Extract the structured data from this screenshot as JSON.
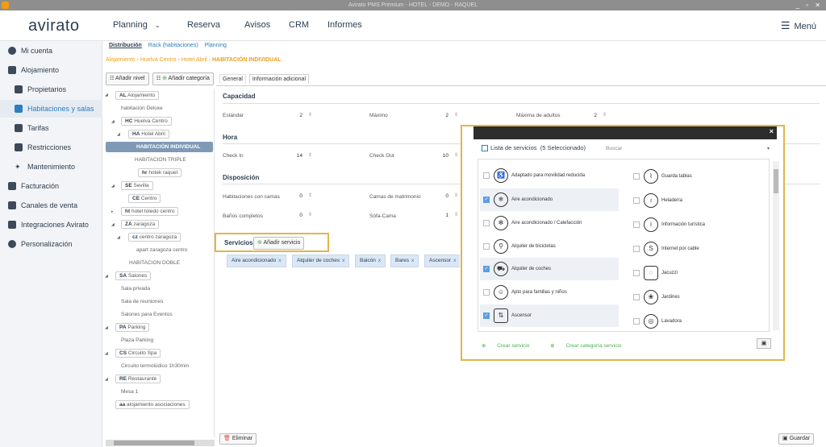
{
  "window": {
    "title": "Avirato PMS Premium - HOTEL - DEMO - RAQUEL",
    "controls": "_ ▫ ✕"
  },
  "topnav": {
    "logo": "avirato",
    "items": [
      "Planning",
      "Reserva",
      "Avisos",
      "CRM",
      "Informes"
    ],
    "menu_label": "Menú"
  },
  "sidebar": {
    "items": [
      {
        "label": "Mi cuenta",
        "icon": "user-icon"
      },
      {
        "label": "Alojamiento",
        "icon": "building-icon"
      },
      {
        "label": "Propietarios",
        "icon": "person-icon"
      },
      {
        "label": "Habitaciones y salas",
        "icon": "bed-icon"
      },
      {
        "label": "Tarifas",
        "icon": "list-icon"
      },
      {
        "label": "Restricciones",
        "icon": "calendar-icon"
      },
      {
        "label": "Mantenimiento",
        "icon": "tools-icon"
      },
      {
        "label": "Facturación",
        "icon": "invoice-icon"
      },
      {
        "label": "Canales de venta",
        "icon": "grid-icon"
      },
      {
        "label": "Integraciones Avirato",
        "icon": "plug-icon"
      },
      {
        "label": "Personalización",
        "icon": "gear-icon"
      }
    ]
  },
  "subtabs": [
    "Distribución",
    "Rack (habitaciones)",
    "Planning"
  ],
  "breadcrumb": {
    "items": [
      "Alojamiento",
      "Huelva Centro",
      "Hotel Abril"
    ],
    "current": "HABITACIÓN INDIVIDUAL",
    "sep": "›"
  },
  "tree_buttons": {
    "add_level": "Añadir nivel",
    "add_category": "Añadir categoría"
  },
  "tree": [
    {
      "code": "AL",
      "label": "Alojamiento"
    },
    {
      "label": "habitacion Deluxe"
    },
    {
      "code": "HC",
      "label": "Huelva Centro"
    },
    {
      "code": "HA",
      "label": "Hotel Abril"
    },
    {
      "label": "HABITACIÓN INDIVIDUAL"
    },
    {
      "label": "HABITACION TRIPLE"
    },
    {
      "code": "hr",
      "label": "hotek raquel"
    },
    {
      "code": "SE",
      "label": "Sevilla"
    },
    {
      "code": "CE",
      "label": "Centro"
    },
    {
      "code": "ht",
      "label": "hotel toledo centro"
    },
    {
      "code": "ZA",
      "label": "zaragoza"
    },
    {
      "code": "cz",
      "label": "centro zaragoza"
    },
    {
      "label": "apart zaragoza centro"
    },
    {
      "label": "HABITACION DOBLE"
    },
    {
      "code": "SA",
      "label": "Salones"
    },
    {
      "label": "Sala privada"
    },
    {
      "label": "Sala de reuniones"
    },
    {
      "label": "Salones para Eventos"
    },
    {
      "code": "PA",
      "label": "Parking"
    },
    {
      "label": "Plaza Parking"
    },
    {
      "code": "CS",
      "label": "Circuito Spa"
    },
    {
      "label": "Circuito termolúdico 1h30min"
    },
    {
      "code": "RE",
      "label": "Restaurante"
    },
    {
      "label": "Mesa 1"
    },
    {
      "code": "aa",
      "label": "alojamiento asociaciones"
    }
  ],
  "panel_tabs": [
    "General",
    "Información adicional"
  ],
  "capacidad": {
    "title": "Capacidad",
    "estandar_label": "Estándar",
    "estandar": "2",
    "maximo_label": "Máximo",
    "maximo": "2",
    "max_adultos_label": "Máxima de adultos",
    "max_adultos": "2"
  },
  "hora": {
    "title": "Hora",
    "checkin_label": "Check In",
    "checkin": "14",
    "checkout_label": "Check Out",
    "checkout": "10"
  },
  "disposicion": {
    "title": "Disposición",
    "hab_camas_label": "Habitaciones con camas",
    "hab_camas": "0",
    "camas_matr_label": "Camas de matrimonio",
    "camas_matr": "0",
    "banos_label": "Baños completos",
    "banos": "0",
    "sofa_label": "Sófa-Cama",
    "sofa": "1"
  },
  "servicios": {
    "title": "Servicios",
    "add_label": "Añadir servicio"
  },
  "chips": [
    "Aire acondicionado",
    "Alquiler de coches",
    "Balcón",
    "Bares",
    "Ascensor"
  ],
  "chip_remove": "x",
  "bottom": {
    "delete_label": "Eliminar",
    "save_label": "Guardar"
  },
  "modal": {
    "title": "Lista de servicios",
    "count": "(5 Seleccionado)",
    "search": "Buscar",
    "close": "×",
    "left": [
      {
        "label": "Adaptado para movilidad reducida",
        "checked": false,
        "icon": "wheelchair-icon"
      },
      {
        "label": "Aire acondicionado",
        "checked": true,
        "icon": "snowflake-icon"
      },
      {
        "label": "Aire acondicionado / Calefacción",
        "checked": false,
        "icon": "snow-sun-icon"
      },
      {
        "label": "Alquiler de bicicletas",
        "checked": false,
        "icon": "bicycle-icon"
      },
      {
        "label": "Alquiler de coches",
        "checked": true,
        "icon": "car-icon"
      },
      {
        "label": "Apto para familias y niños",
        "checked": false,
        "icon": "family-icon"
      },
      {
        "label": "Ascensor",
        "checked": true,
        "icon": "elevator-icon"
      }
    ],
    "right": [
      {
        "label": "Guarda tablas",
        "checked": false,
        "icon": "surfboard-icon"
      },
      {
        "label": "Heladería",
        "checked": false,
        "icon": "icecream-icon"
      },
      {
        "label": "Información turística",
        "checked": false,
        "icon": "info-icon"
      },
      {
        "label": "Internet por cable",
        "checked": false,
        "icon": "cable-icon"
      },
      {
        "label": "Jacuzzi",
        "checked": false,
        "icon": "jacuzzi-icon"
      },
      {
        "label": "Jardines",
        "checked": false,
        "icon": "garden-icon"
      },
      {
        "label": "Lavadora",
        "checked": false,
        "icon": "washer-icon"
      }
    ],
    "create_service": "Crear servicio",
    "create_category": "Crear categoría servicio"
  },
  "colors": {
    "accent": "#2a7fc0",
    "highlight": "#e0b64a",
    "breadcrumb": "#f39c12",
    "selected_node": "#7f9ab5"
  }
}
